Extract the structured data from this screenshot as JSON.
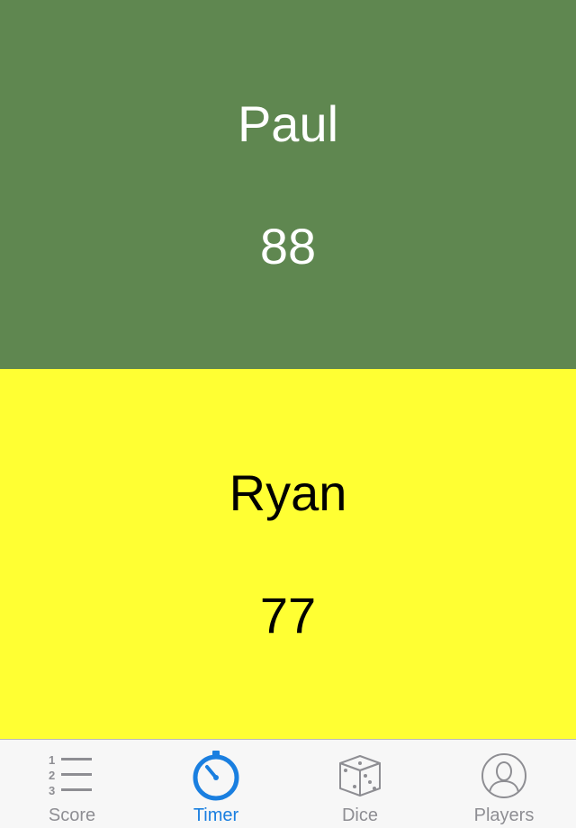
{
  "players": [
    {
      "name": "Paul",
      "score": "88",
      "color": "#5f8750",
      "text_color": "#ffffff"
    },
    {
      "name": "Ryan",
      "score": "77",
      "color": "#ffff33",
      "text_color": "#000000"
    }
  ],
  "tabbar": {
    "active": "Timer",
    "active_color": "#1a7fe0",
    "inactive_color": "#8e8e93",
    "tabs": [
      {
        "label": "Score",
        "icon": "numbered-list-icon"
      },
      {
        "label": "Timer",
        "icon": "stopwatch-icon"
      },
      {
        "label": "Dice",
        "icon": "dice-icon"
      },
      {
        "label": "Players",
        "icon": "person-icon"
      }
    ]
  }
}
